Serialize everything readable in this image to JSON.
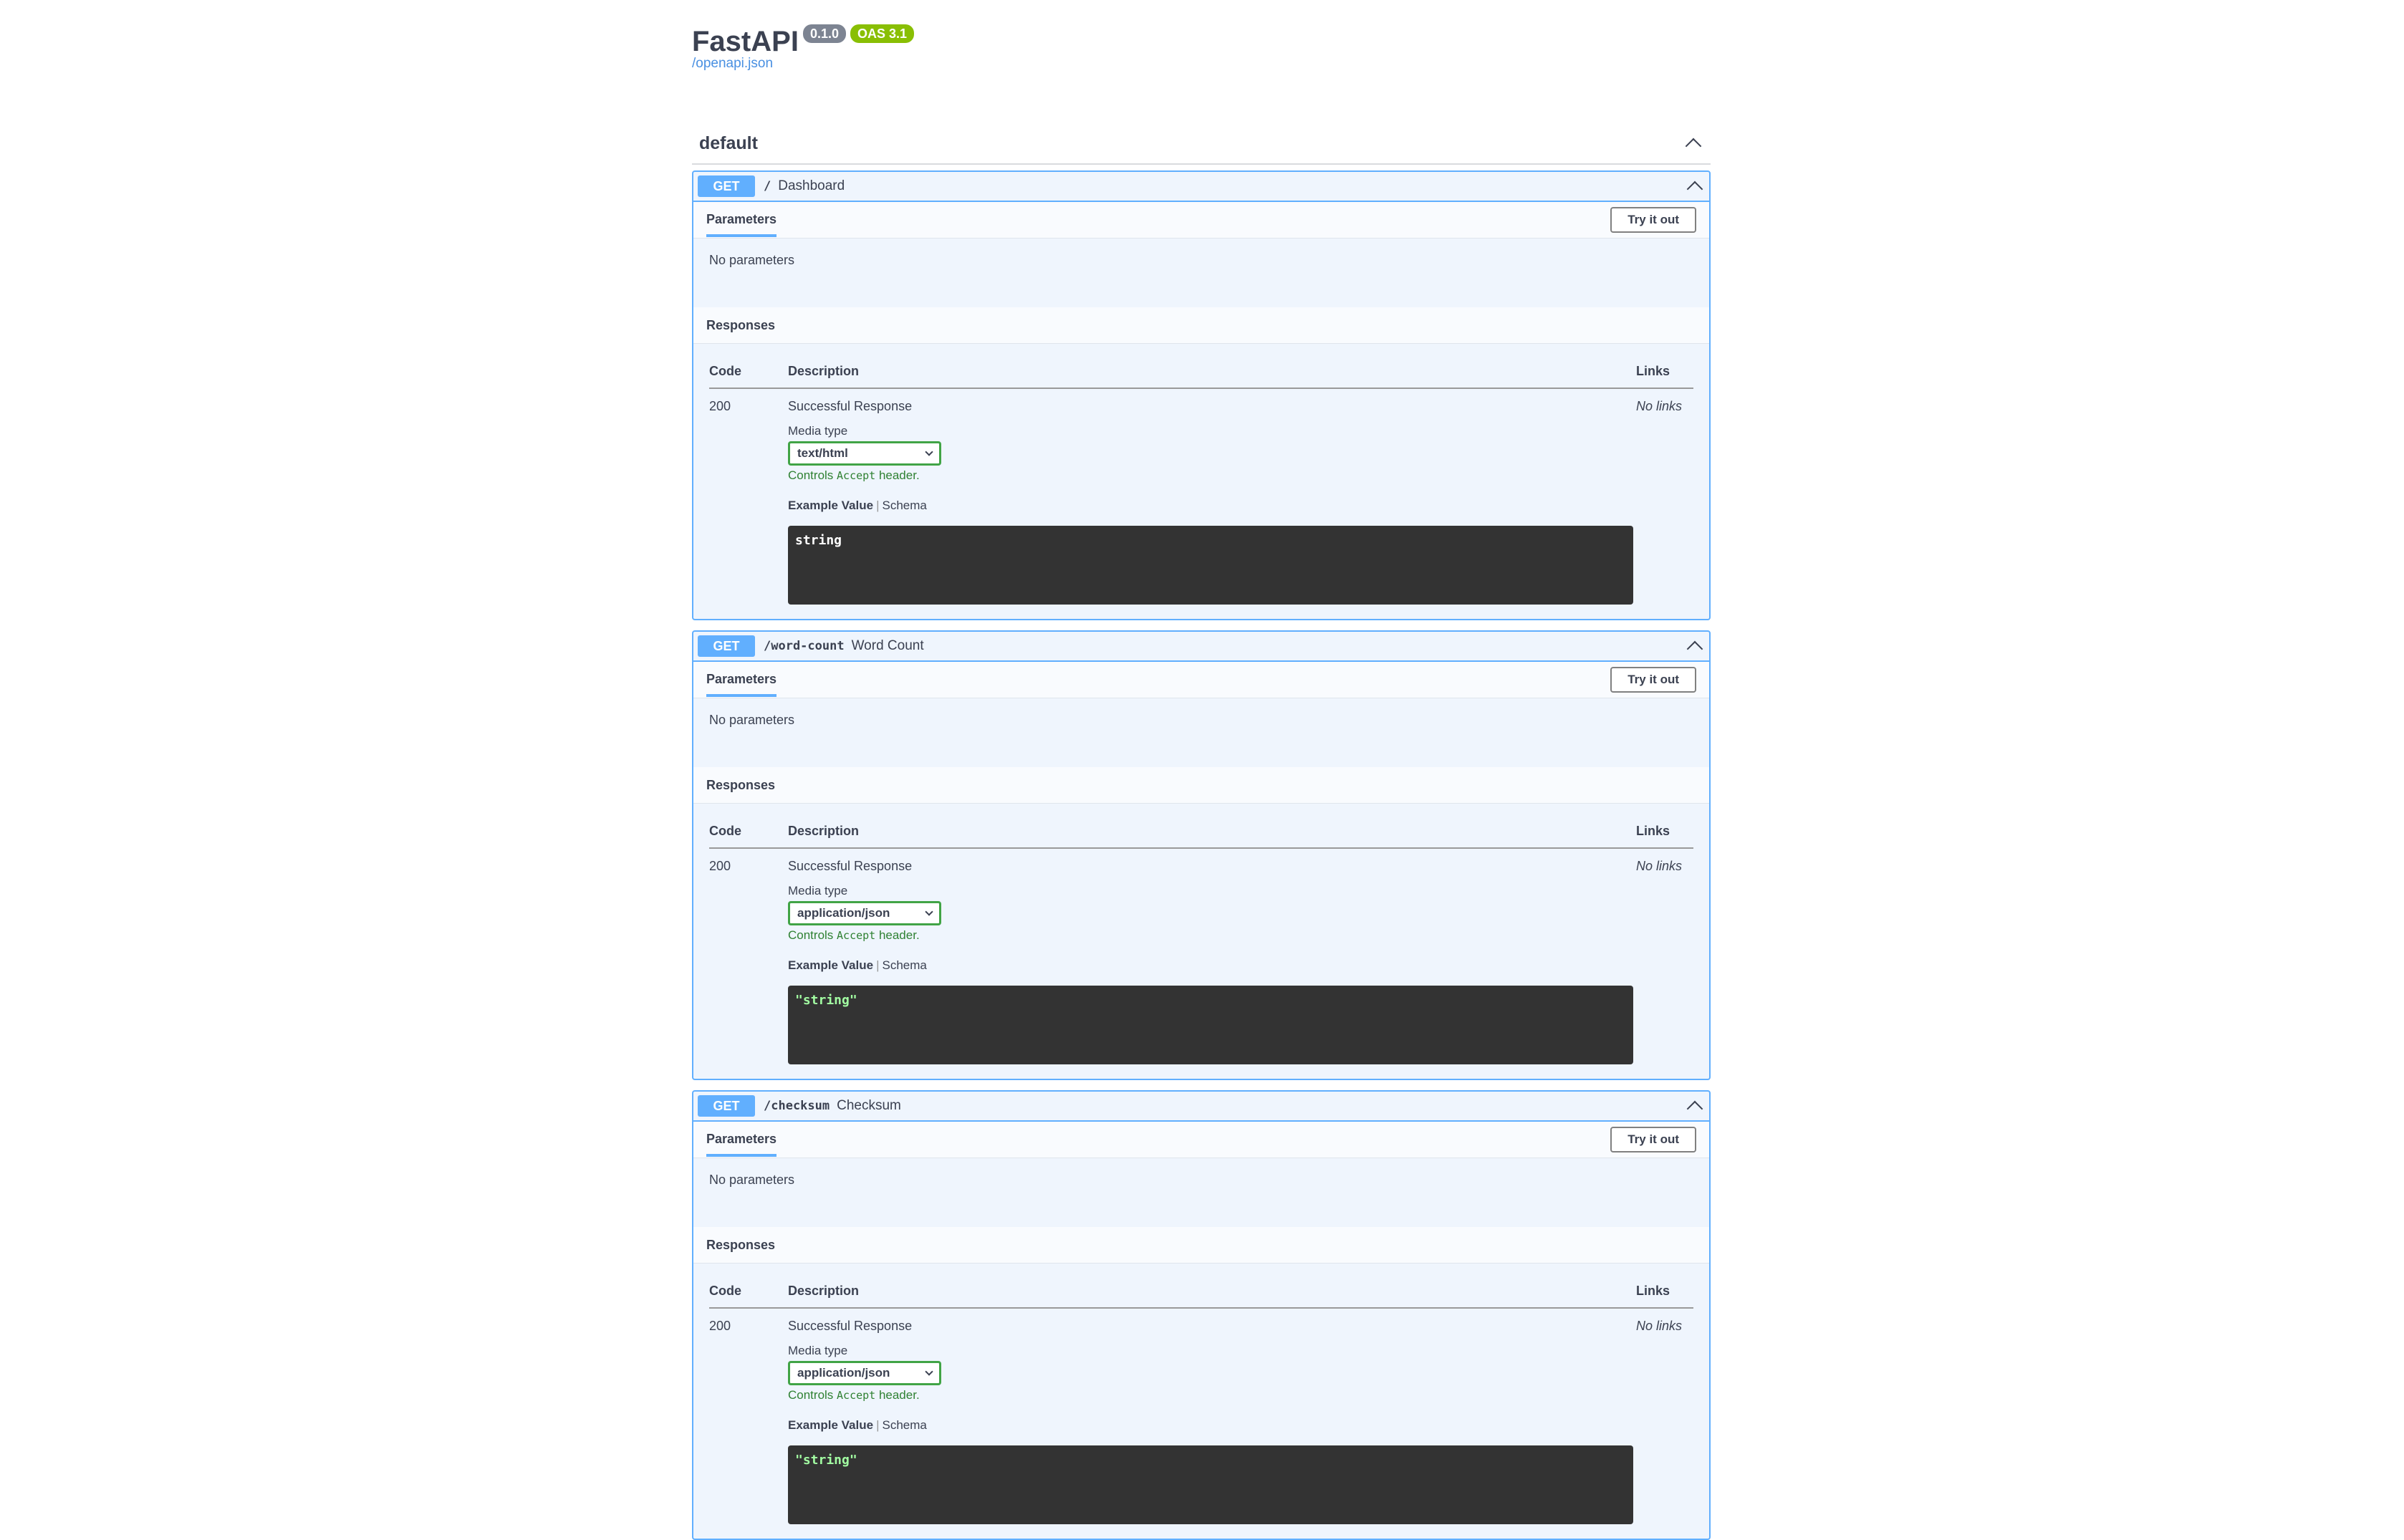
{
  "info": {
    "title": "FastAPI",
    "version": "0.1.0",
    "oas": "OAS 3.1",
    "spec_link": "/openapi.json"
  },
  "tag": {
    "name": "default"
  },
  "labels": {
    "parameters": "Parameters",
    "try_it_out": "Try it out",
    "no_parameters": "No parameters",
    "responses": "Responses",
    "code": "Code",
    "description": "Description",
    "links": "Links",
    "media_type": "Media type",
    "controls_prefix": "Controls ",
    "controls_code": "Accept",
    "controls_suffix": " header.",
    "example_value": "Example Value",
    "schema": "Schema",
    "no_links": "No links"
  },
  "operations": [
    {
      "method": "GET",
      "path": "/",
      "summary": "Dashboard",
      "response_code": "200",
      "response_desc": "Successful Response",
      "media_type": "text/html",
      "example": "string"
    },
    {
      "method": "GET",
      "path": "/word-count",
      "summary": "Word Count",
      "response_code": "200",
      "response_desc": "Successful Response",
      "media_type": "application/json",
      "example": "\"string\""
    },
    {
      "method": "GET",
      "path": "/checksum",
      "summary": "Checksum",
      "response_code": "200",
      "response_desc": "Successful Response",
      "media_type": "application/json",
      "example": "\"string\""
    }
  ],
  "colors": {
    "get": "#61affe",
    "media_border": "#41a446",
    "accept_note": "#2f8132",
    "code_bg": "#333333"
  }
}
